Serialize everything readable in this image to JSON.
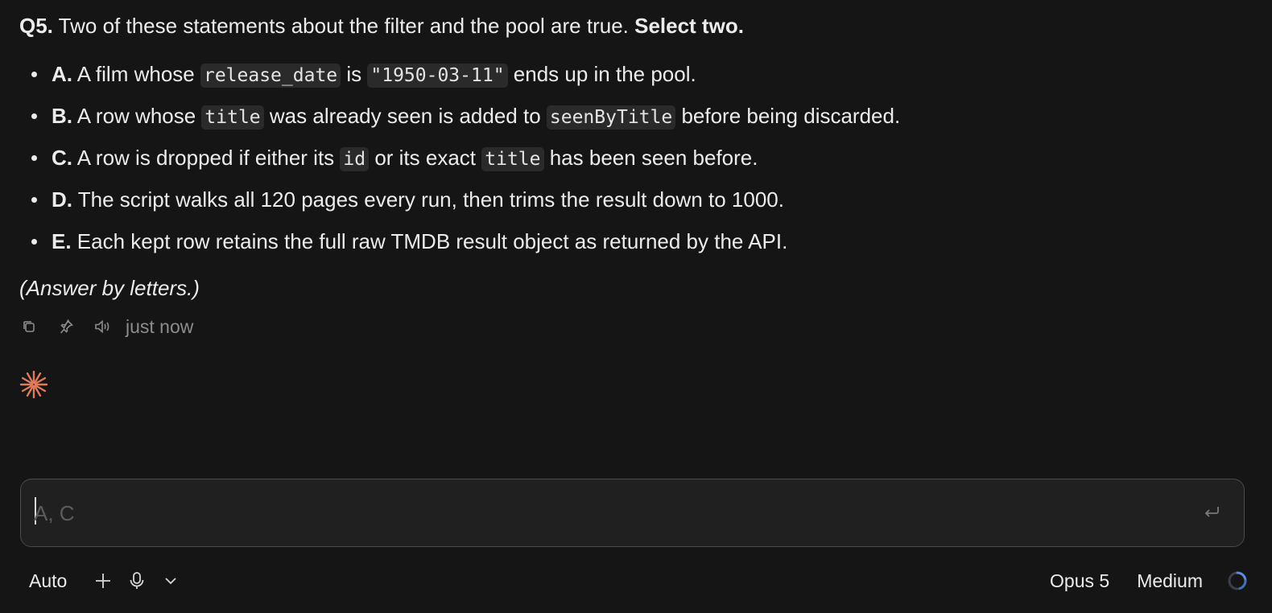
{
  "question": {
    "number": "Q5.",
    "text": " Two of these statements about the filter and the pool are true. ",
    "instruction": "Select two."
  },
  "options": [
    {
      "letter": "A.",
      "parts": [
        {
          "t": " A film whose "
        },
        {
          "code": "release_date"
        },
        {
          "t": " is "
        },
        {
          "code": "\"1950-03-11\""
        },
        {
          "t": " ends up in the pool."
        }
      ]
    },
    {
      "letter": "B.",
      "parts": [
        {
          "t": " A row whose "
        },
        {
          "code": "title"
        },
        {
          "t": " was already seen is added to "
        },
        {
          "code": "seenByTitle"
        },
        {
          "t": " before being discarded."
        }
      ]
    },
    {
      "letter": "C.",
      "parts": [
        {
          "t": " A row is dropped if either its "
        },
        {
          "code": "id"
        },
        {
          "t": " or its exact "
        },
        {
          "code": "title"
        },
        {
          "t": " has been seen before."
        }
      ]
    },
    {
      "letter": "D.",
      "parts": [
        {
          "t": " The script walks all 120 pages every run, then trims the result down to 1000."
        }
      ]
    },
    {
      "letter": "E.",
      "parts": [
        {
          "t": " Each kept row retains the full raw TMDB result object as returned by the API."
        }
      ]
    }
  ],
  "hint": "(Answer by letters.)",
  "message_meta": {
    "icons": [
      "copy-icon",
      "pin-icon",
      "speaker-icon"
    ],
    "timestamp": "just now"
  },
  "assistant_icon": "sparkle-icon",
  "composer": {
    "value": "",
    "placeholder": "A, C",
    "submit_icon": "enter-icon"
  },
  "toolbar": {
    "mode": "Auto",
    "add_icon": "plus-icon",
    "mic_icon": "microphone-icon",
    "dropdown_icon": "chevron-down-icon",
    "model": "Opus 5",
    "effort": "Medium",
    "status_icon": "spinner-icon"
  },
  "colors": {
    "background": "#151515",
    "text": "#ececec",
    "muted": "#8c8c8c",
    "code_bg": "#2a2a2a",
    "accent_sparkle": "#e07b5a",
    "spinner": "#5a8de0"
  }
}
